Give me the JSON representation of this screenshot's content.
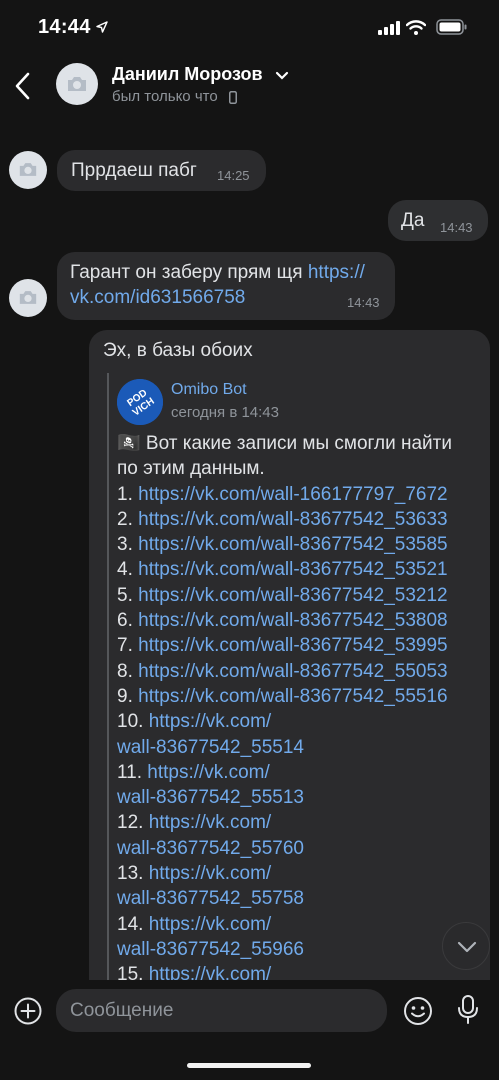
{
  "status": {
    "time": "14:44"
  },
  "header": {
    "name": "Даниил Морозов",
    "status": "был только что"
  },
  "messages": {
    "m1": {
      "text": "Пррдаеш пабг",
      "time": "14:25"
    },
    "m2": {
      "text": "Да",
      "time": "14:43"
    },
    "m3": {
      "text_before": "Гарант он заберу прям щя ",
      "link_part1": "https://",
      "link_part2": "vk.com/id631566758",
      "time": "14:43"
    },
    "m4": {
      "text": "Эх, в базы обоих"
    }
  },
  "forward": {
    "bot_name": "Omibo Bot",
    "bot_avatar_text": "POD VICH",
    "date": "сегодня в 14:43",
    "intro_line1": "🏴‍☠️ Вот какие записи мы смогли найти",
    "intro_line2": "по этим данным.",
    "items": [
      {
        "n": "1. ",
        "url": "https://vk.com/wall-166177797_7672"
      },
      {
        "n": "2. ",
        "url": "https://vk.com/wall-83677542_53633"
      },
      {
        "n": "3. ",
        "url": "https://vk.com/wall-83677542_53585"
      },
      {
        "n": "4. ",
        "url": "https://vk.com/wall-83677542_53521"
      },
      {
        "n": "5. ",
        "url": "https://vk.com/wall-83677542_53212"
      },
      {
        "n": "6. ",
        "url": "https://vk.com/wall-83677542_53808"
      },
      {
        "n": "7. ",
        "url": "https://vk.com/wall-83677542_53995"
      },
      {
        "n": "8. ",
        "url": "https://vk.com/wall-83677542_55053"
      },
      {
        "n": "9. ",
        "url": "https://vk.com/wall-83677542_55516"
      }
    ],
    "wrapped": [
      {
        "n": "10. ",
        "url_a": "https://vk.com/",
        "url_b": "wall-83677542_55514"
      },
      {
        "n": "11. ",
        "url_a": "https://vk.com/",
        "url_b": "wall-83677542_55513"
      },
      {
        "n": "12. ",
        "url_a": "https://vk.com/",
        "url_b": "wall-83677542_55760"
      },
      {
        "n": "13. ",
        "url_a": "https://vk.com/",
        "url_b": "wall-83677542_55758"
      },
      {
        "n": "14. ",
        "url_a": "https://vk.com/",
        "url_b": "wall-83677542_55966"
      }
    ],
    "partial": {
      "n": "15. ",
      "url_a": "https://vk.com/"
    }
  },
  "composer": {
    "placeholder": "Сообщение"
  },
  "icons": {
    "back": "chevron-left-icon",
    "camera": "camera-icon",
    "plus": "plus-icon",
    "smile": "smile-icon",
    "mic": "mic-icon",
    "scroll": "chevron-down-icon"
  },
  "colors": {
    "background": "#141414",
    "bubble": "#2b2b2d",
    "link": "#71aaeb",
    "muted": "#8f949a",
    "bot_avatar": "#1b5ab8"
  }
}
